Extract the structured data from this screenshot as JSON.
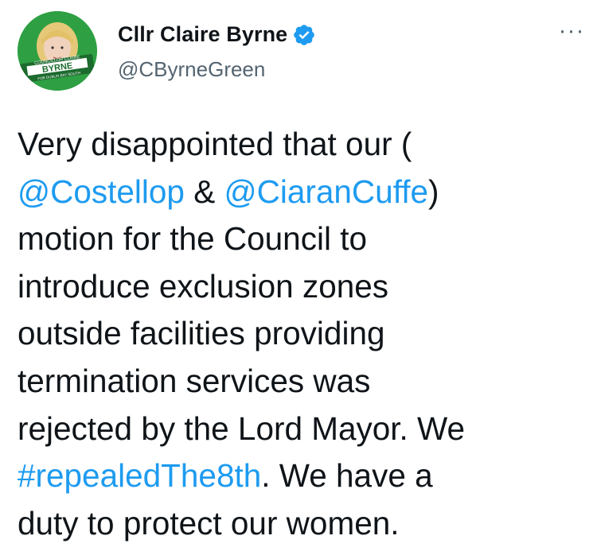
{
  "author": {
    "name": "Cllr Claire Byrne",
    "handle": "@CByrneGreen",
    "avatar_text": {
      "top": "COUNCILLOR CLAIRE",
      "name": "BYRNE",
      "bottom": "FOR DUBLIN BAY SOUTH"
    },
    "verified_icon": "verified-badge-icon",
    "brand_color": "#2ea043"
  },
  "menu": {
    "more_label": "···"
  },
  "tweet": {
    "line1": "Very disappointed that our (",
    "mention1": "@Costellop",
    "amp": " & ",
    "mention2": "@CiaranCuffe",
    "paren": ")",
    "line3": "motion for the Council to",
    "line4": "introduce exclusion zones",
    "line5": "outside facilities providing",
    "line6": "termination services was",
    "line7": "rejected by the Lord Mayor. We",
    "hashtag": "#repealedThe8th",
    "after_hashtag": ". We have a",
    "line9": "duty to protect our women."
  },
  "colors": {
    "link": "#1d9bf0",
    "text": "#0f1419",
    "secondary": "#536471"
  }
}
